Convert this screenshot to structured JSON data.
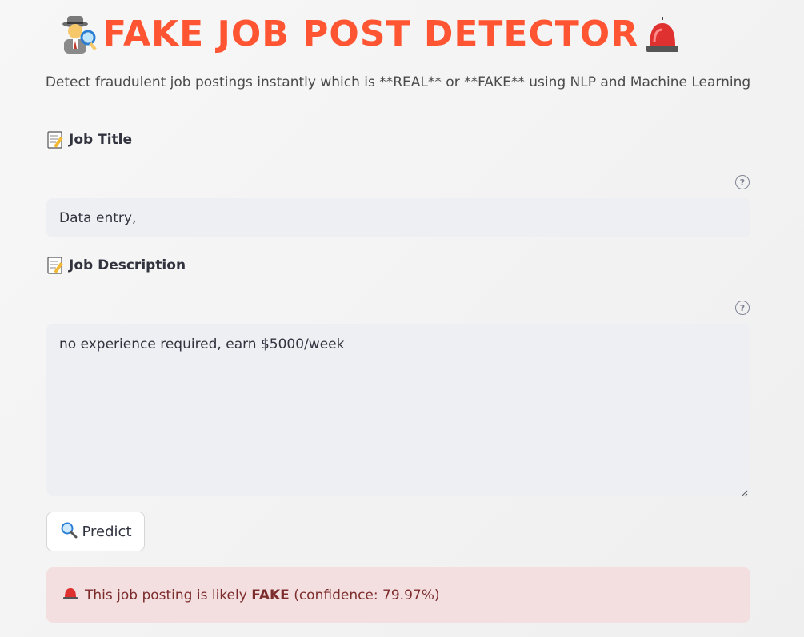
{
  "header": {
    "title": "FAKE JOB POST DETECTOR",
    "left_icon": "detective-emoji-icon",
    "right_icon": "siren-emoji-icon",
    "title_color": "#ff5533"
  },
  "subtitle": "Detect fraudulent job postings instantly which is **REAL** or **FAKE** using NLP and Machine Learning",
  "job_title": {
    "label": "Job Title",
    "icon": "memo-icon",
    "value": "Data entry,"
  },
  "job_description": {
    "label": "Job Description",
    "icon": "memo-icon",
    "value": "no experience required, earn $5000/week"
  },
  "predict_button": {
    "icon": "magnifier-icon",
    "label": "Predict"
  },
  "result": {
    "icon": "siren-icon",
    "prefix": "This job posting is likely",
    "verdict": "FAKE",
    "suffix": "(confidence: 79.97%)",
    "background": "#f4dfe0"
  },
  "help_glyph": "?"
}
